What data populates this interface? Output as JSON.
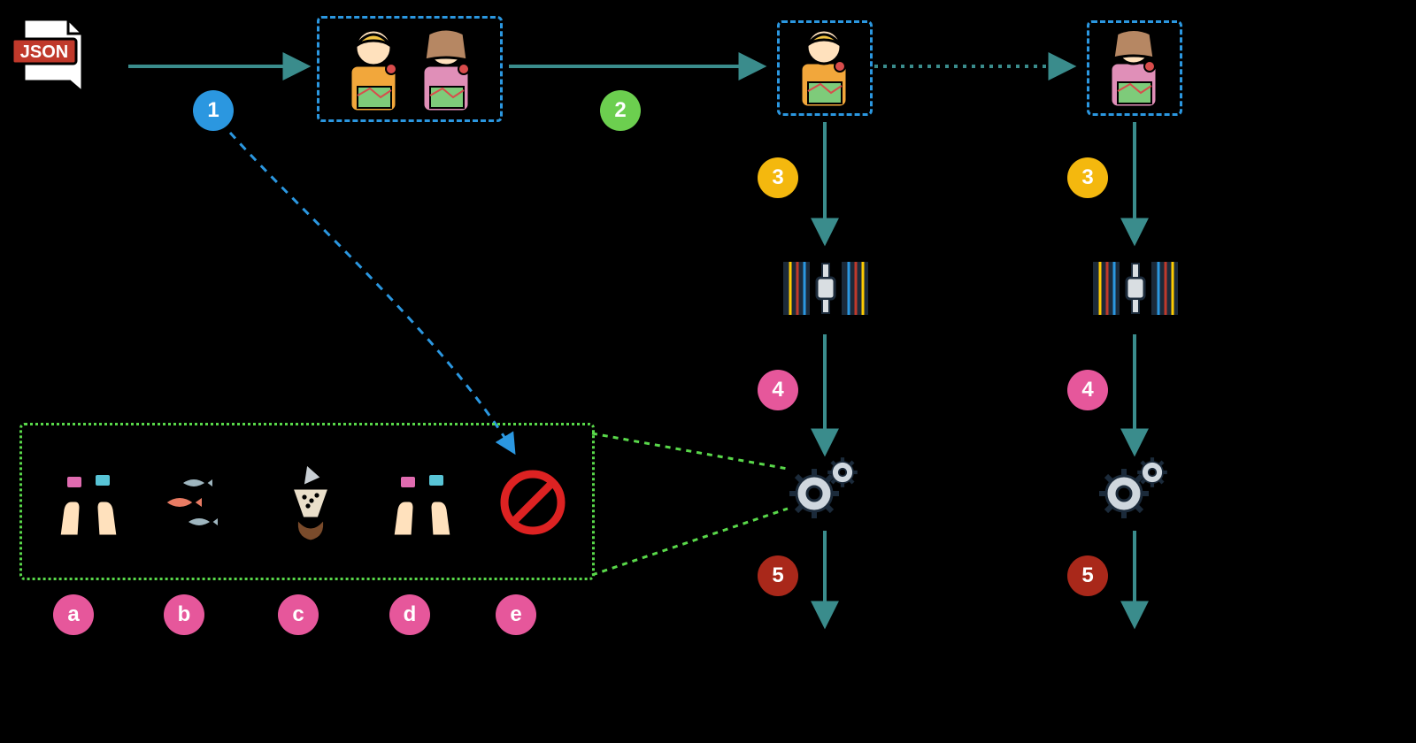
{
  "badges": {
    "step1": "1",
    "step2": "2",
    "step3": "3",
    "step4": "4",
    "step5": "5",
    "det_a": "a",
    "det_b": "b",
    "det_c": "c",
    "det_d": "d",
    "det_e": "e"
  },
  "icons": {
    "file_label": "JSON",
    "origin": "json-file",
    "pair": "cartographer-pair",
    "cartographer_m": "male-cartographer",
    "cartographer_f": "female-cartographer",
    "satellite": "satellite-station",
    "gears": "processing-gears",
    "no": "no-entry",
    "detail_a": "hands-with-tools",
    "detail_b": "fish-shoal",
    "detail_c": "coffee-filter",
    "detail_d": "hands-with-tools",
    "detail_e": "no-entry"
  },
  "colors": {
    "blue": "#2b97e0",
    "green": "#6ccf4f",
    "yellow": "#f4b80e",
    "pink": "#e6579b",
    "darkred": "#a9281a",
    "teal": "#3a8c8c",
    "greenDash": "#59d84a"
  },
  "flow": {
    "arrow1": "solid",
    "arrow2": "solid",
    "arrow_pair_to_f": "dotted",
    "arrow3": "solid",
    "arrow4": "solid",
    "arrow5": "solid",
    "detail_pointer": "dashed"
  }
}
